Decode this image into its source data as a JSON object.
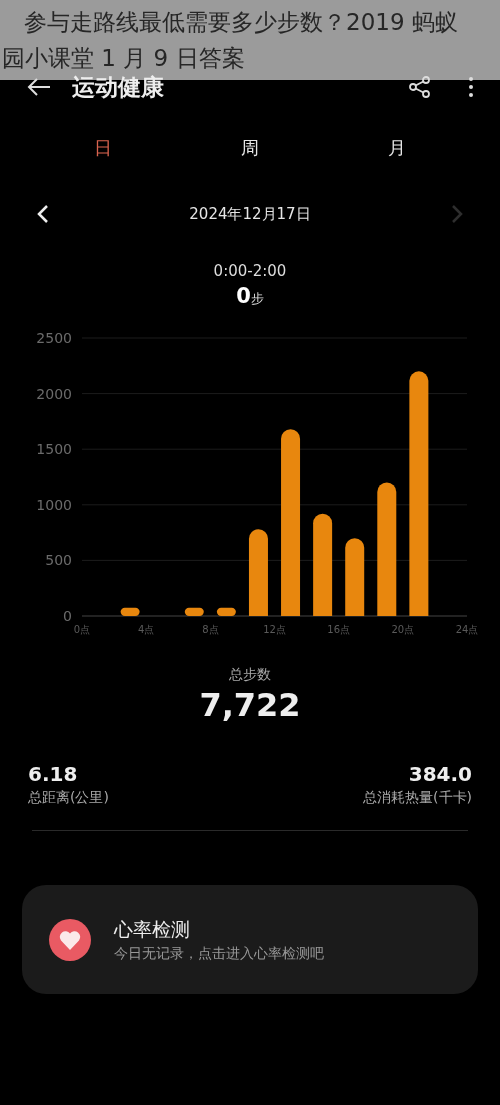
{
  "caption": {
    "lines": [
      "参与走路线最低需要多少步数？2019 蚂蚁",
      "园小课堂 1 月 9 日答案"
    ]
  },
  "header": {
    "title": "运动健康"
  },
  "tabs": [
    {
      "label": "日",
      "selected": true
    },
    {
      "label": "周",
      "selected": false
    },
    {
      "label": "月",
      "selected": false
    }
  ],
  "date_nav": {
    "date": "2024年12月17日",
    "next_disabled": true
  },
  "selection": {
    "range": "0:00-2:00",
    "value": "0",
    "unit": "步"
  },
  "chart": {
    "chart_data": {
      "type": "bar",
      "x": [
        1,
        3,
        5,
        7,
        9,
        11,
        13,
        15,
        17,
        19,
        21,
        23
      ],
      "xlim": [
        0,
        24
      ],
      "ylim": [
        0,
        2500
      ],
      "grid": true,
      "series": [
        {
          "color": "#e8870e",
          "values": [
            0,
            75,
            0,
            75,
            75,
            780,
            1680,
            920,
            700,
            1200,
            2200,
            0
          ]
        }
      ],
      "xticks": [
        {
          "value": 0,
          "label": "0点"
        },
        {
          "value": 4,
          "label": "4点"
        },
        {
          "value": 8,
          "label": "8点"
        },
        {
          "value": 12,
          "label": "12点"
        },
        {
          "value": 16,
          "label": "16点"
        },
        {
          "value": 20,
          "label": "20点"
        },
        {
          "value": 24,
          "label": "24点"
        }
      ],
      "yticks": [
        0,
        500,
        1000,
        1500,
        2000,
        2500
      ]
    }
  },
  "total": {
    "label": "总步数",
    "value": "7,722"
  },
  "stats": [
    {
      "value": "6.18",
      "label": "总距离(公里)"
    },
    {
      "value": "384.0",
      "label": "总消耗热量(千卡)"
    }
  ],
  "heart_card": {
    "title": "心率检测",
    "subtitle": "今日无记录，点击进入心率检测吧"
  }
}
